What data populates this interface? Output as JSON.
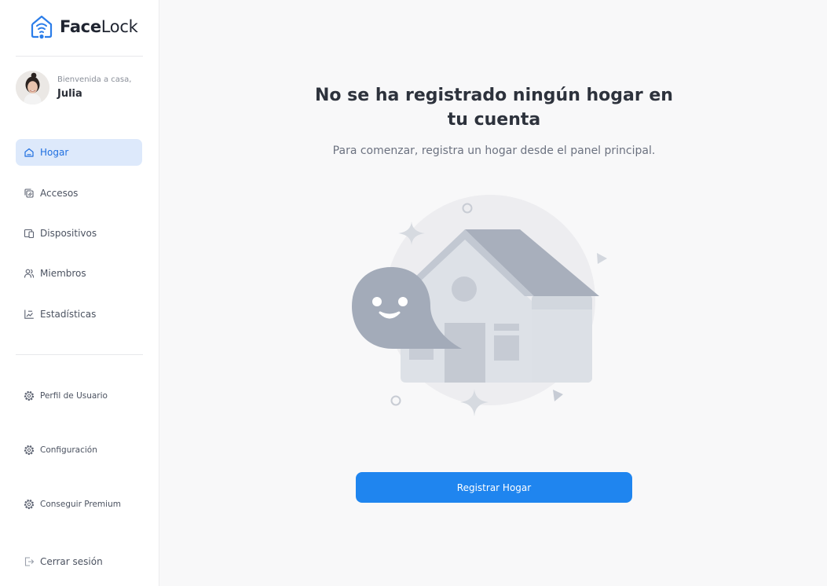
{
  "brand": {
    "name_bold": "Face",
    "name_regular": "Lock"
  },
  "user": {
    "greeting": "Bienvenida a casa,",
    "name": "Julia"
  },
  "nav": {
    "items": [
      {
        "label": "Hogar",
        "icon": "home-icon",
        "active": true
      },
      {
        "label": "Accesos",
        "icon": "access-icon"
      },
      {
        "label": "Dispositivos",
        "icon": "devices-icon"
      },
      {
        "label": "Miembros",
        "icon": "members-icon"
      },
      {
        "label": "Estadísticas",
        "icon": "stats-icon"
      }
    ],
    "secondary": [
      {
        "label": "Perfil de Usuario",
        "icon": "gear-icon"
      },
      {
        "label": "Configuración",
        "icon": "gear-icon"
      },
      {
        "label": "Conseguir Premium",
        "icon": "gear-icon"
      }
    ],
    "logout": {
      "label": "Cerrar sesión",
      "icon": "logout-icon"
    }
  },
  "main": {
    "title": "No se ha registrado ningún hogar en tu cuenta",
    "subtitle": "Para comenzar, registra un hogar desde el panel principal.",
    "cta_label": "Registrar Hogar",
    "illustration": "empty-house-illustration"
  },
  "colors": {
    "accent": "#1f85ef",
    "active_bg": "#dde9fb",
    "active_text": "#1f6fe0",
    "background": "#f8f8f9"
  }
}
